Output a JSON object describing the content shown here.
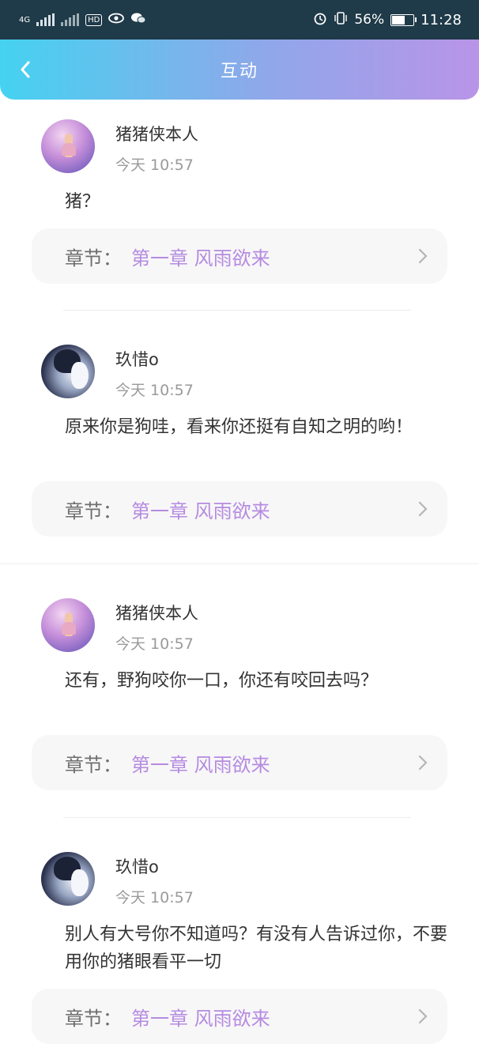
{
  "status_bar": {
    "network": "4G",
    "battery_pct": "56%",
    "time": "11:28",
    "icons": [
      "signal-icon",
      "signal-icon",
      "hd-icon",
      "eye-icon",
      "wechat-icon",
      "alarm-icon",
      "vibrate-icon",
      "battery-icon"
    ]
  },
  "header": {
    "title": "互动"
  },
  "comments": [
    {
      "user": "猪猪侠本人",
      "time": "今天 10:57",
      "text": "猪？",
      "chapter_label": "章节：",
      "chapter_title": "第一章 风雨欲来",
      "avatar": "girl-avatar"
    },
    {
      "user": "玖惜o",
      "time": "今天 10:57",
      "text": "原来你是狗哇，看来你还挺有自知之明的哟！",
      "chapter_label": "章节：",
      "chapter_title": "第一章 风雨欲来",
      "avatar": "anime-avatar"
    },
    {
      "user": "猪猪侠本人",
      "time": "今天 10:57",
      "text": "还有，野狗咬你一口，你还有咬回去吗？",
      "chapter_label": "章节：",
      "chapter_title": "第一章 风雨欲来",
      "avatar": "girl-avatar"
    },
    {
      "user": "玖惜o",
      "time": "今天 10:57",
      "text": "别人有大号你不知道吗？有没有人告诉过你，不要用你的猪眼看平一切",
      "chapter_label": "章节：",
      "chapter_title": "第一章 风雨欲来",
      "avatar": "anime-avatar"
    }
  ],
  "colors": {
    "header_start": "#45d2f1",
    "header_end": "#b994e8",
    "chapter_title": "#b68be0",
    "status_bar": "#1f3a48"
  }
}
